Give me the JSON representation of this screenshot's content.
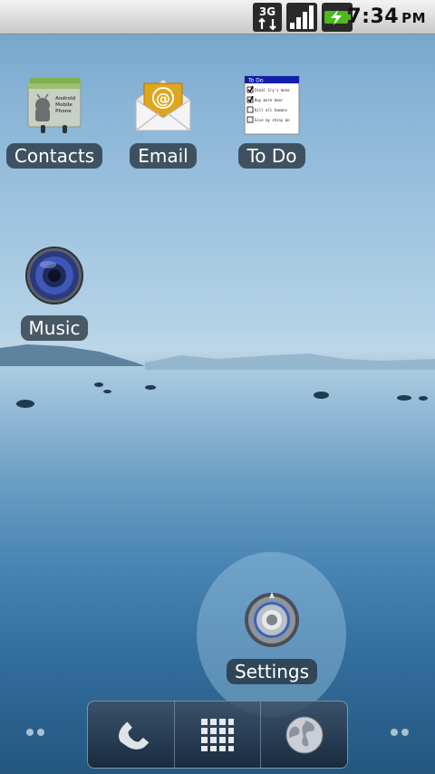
{
  "status_bar": {
    "network": "3G",
    "time": "7:34",
    "ampm": "PM"
  },
  "apps": [
    {
      "label": "Contacts",
      "icon": "contacts-icon"
    },
    {
      "label": "Email",
      "icon": "email-icon"
    },
    {
      "label": "To Do",
      "icon": "todo-icon"
    },
    {
      "label": "Music",
      "icon": "music-icon"
    }
  ],
  "contacts_card": {
    "line1": "Android",
    "line2": "Mobile",
    "line3": "Phone"
  },
  "email_symbol": "@",
  "todo_preview": {
    "title": "To Do",
    "items": [
      "Steal Cry's mone",
      "Buy more beer",
      "Kill all humans",
      "Give my shiny me"
    ]
  },
  "highlighted_app": {
    "label": "Settings",
    "icon": "settings-icon"
  },
  "dock": {
    "buttons": [
      "phone-icon",
      "app-drawer-icon",
      "browser-icon"
    ]
  },
  "colors": {
    "status_bar": "#dcdcdc",
    "label_bg": "#1e2832",
    "battery_green": "#4db81f"
  }
}
